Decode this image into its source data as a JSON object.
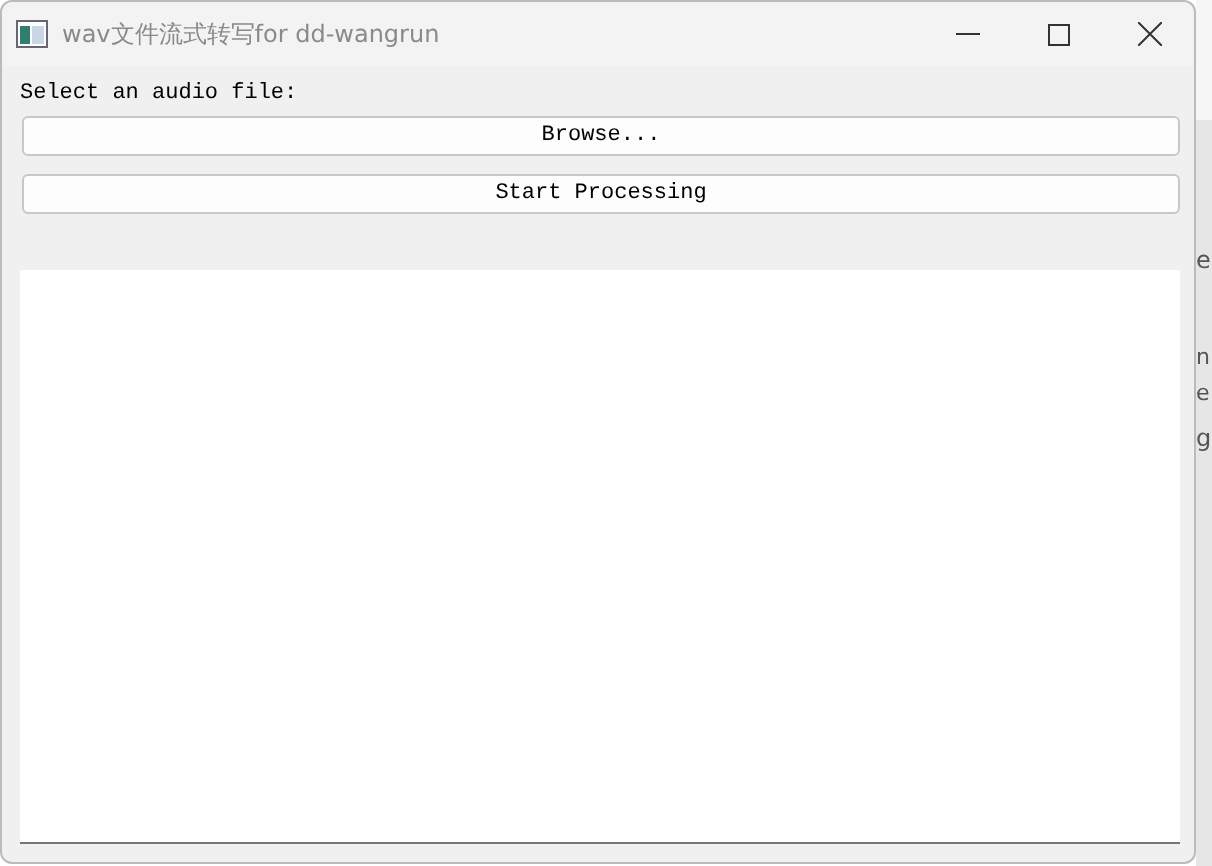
{
  "window": {
    "title": "wav文件流式转写for dd-wangrun"
  },
  "prompt": "Select an audio file:",
  "buttons": [
    "Browse...",
    "Start Processing"
  ],
  "background_window": {
    "fragments": [
      "e",
      "n",
      "e",
      "g"
    ]
  }
}
